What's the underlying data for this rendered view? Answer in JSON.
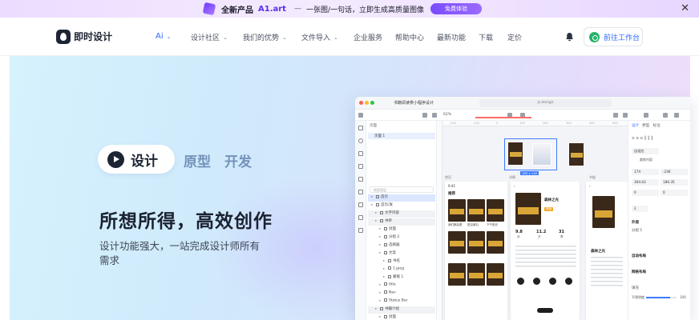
{
  "promo": {
    "prefix": "全新产品",
    "brand": "A1.art",
    "separator": "—",
    "tagline": "一张图/一句话，立即生成高质量图像",
    "button": "免费体验",
    "close_icon": "close-icon"
  },
  "nav": {
    "logo": "即时设计",
    "items": [
      {
        "label": "Ai",
        "dropdown": true
      },
      {
        "label": "设计社区",
        "dropdown": true
      },
      {
        "label": "我们的优势",
        "dropdown": true
      },
      {
        "label": "文件导入",
        "dropdown": true
      },
      {
        "label": "企业服务",
        "dropdown": false
      },
      {
        "label": "帮助中心",
        "dropdown": false
      },
      {
        "label": "最新功能",
        "dropdown": false
      },
      {
        "label": "下载",
        "dropdown": false
      },
      {
        "label": "定价",
        "dropdown": false
      }
    ],
    "bell_icon": "bell-icon",
    "cta": "前往工作台",
    "accent": "#2f6bff"
  },
  "hero": {
    "modes": [
      "设计",
      "原型",
      "开发"
    ],
    "headline": "所想所得，高效创作",
    "subtitle": "设计功能强大，一站完成设计师所有需求"
  },
  "mockup": {
    "window_title": "书籍阅读类小程序设计",
    "url": "js.design",
    "zoom": "62%",
    "layers_header": "页面",
    "page": "页面 1",
    "search_placeholder": "搜索图层",
    "layers": [
      {
        "label": "首页",
        "state": "sel"
      },
      {
        "label": "首页/发",
        "state": ""
      },
      {
        "label": "文字内容",
        "state": "grp"
      },
      {
        "label": "书单",
        "state": "grp"
      },
      {
        "label": "封面",
        "state": ""
      },
      {
        "label": "分组 2",
        "state": ""
      },
      {
        "label": "选择器",
        "state": ""
      },
      {
        "label": "文案",
        "state": ""
      },
      {
        "label": "书名",
        "state": ""
      },
      {
        "label": "1.jpeg",
        "state": ""
      },
      {
        "label": "蒙版 1",
        "state": ""
      },
      {
        "label": "title",
        "state": ""
      },
      {
        "label": "Nav",
        "state": ""
      },
      {
        "label": "Status Bar",
        "state": ""
      },
      {
        "label": "书籍介绍",
        "state": "grp"
      },
      {
        "label": "封面",
        "state": ""
      }
    ],
    "ruler": [
      "-200",
      "-100",
      "0",
      "100",
      "200",
      "300",
      "400",
      "500"
    ],
    "selection_label": "160 x 140",
    "screens": [
      {
        "label": "首页",
        "head": "9:41",
        "title": "推荐"
      },
      {
        "label": "详情",
        "head": "9:41",
        "title": "森林之光"
      },
      {
        "label": "书架",
        "head": "9:41",
        "title": "森林之光"
      }
    ],
    "book_captions": [
      "我们都会是",
      "夏目漱石",
      "下午阳光"
    ],
    "book_title": "森林之光",
    "stats": [
      "9.8",
      "11.2",
      "31"
    ],
    "stat_units": [
      "分",
      "万",
      "章"
    ],
    "tag": "畅销",
    "props": {
      "tabs": [
        "设计",
        "原型",
        "标注"
      ],
      "align_label": "对齐",
      "fill_label": "自适应",
      "clip_label": "裁剪内容",
      "x": "174",
      "y": "-236",
      "w": "304.63",
      "h": "186.35",
      "rotation": "0",
      "radius": "0",
      "corner": "2",
      "layout_section": "自动布局",
      "grid_section": "网格布局",
      "style_section": "外观",
      "component": "分组 1",
      "opacity_label": "不透明度",
      "opacity": "100",
      "fill_section": "填充"
    }
  }
}
